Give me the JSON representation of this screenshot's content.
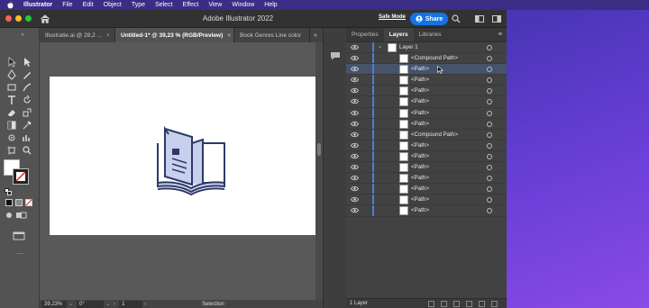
{
  "menubar": {
    "items": [
      "Illustrator",
      "File",
      "Edit",
      "Object",
      "Type",
      "Select",
      "Effect",
      "View",
      "Window",
      "Help"
    ],
    "bg": "#3b2c86"
  },
  "titlebar": {
    "title": "Adobe Illustrator 2022",
    "safe_mode": "Safe Mode",
    "share_label": "Share",
    "accent": "#1473e6"
  },
  "tabs": [
    {
      "label": "Illustratie.ai @ 28,2 ...",
      "active": false
    },
    {
      "label": "Untitled-1* @ 39,23 % (RGB/Preview)",
      "active": true
    },
    {
      "label": "Book Genres Line color",
      "active": false
    }
  ],
  "tabs_overflow": "»",
  "statusbar": {
    "zoom": "39,23%",
    "rotation": "0°",
    "artboard": "1",
    "mode": "Selection"
  },
  "panel": {
    "tabs": [
      "Properties",
      "Layers",
      "Libraries"
    ],
    "active_tab": "Layers",
    "footer": "1 Layer",
    "layer_name": "Layer 1",
    "rows": [
      {
        "label": "<Compound Path>",
        "selected": false
      },
      {
        "label": "<Path>",
        "selected": true
      },
      {
        "label": "<Path>",
        "selected": false
      },
      {
        "label": "<Path>",
        "selected": false
      },
      {
        "label": "<Path>",
        "selected": false
      },
      {
        "label": "<Path>",
        "selected": false
      },
      {
        "label": "<Path>",
        "selected": false
      },
      {
        "label": "<Compound Path>",
        "selected": false
      },
      {
        "label": "<Path>",
        "selected": false
      },
      {
        "label": "<Path>",
        "selected": false
      },
      {
        "label": "<Path>",
        "selected": false
      },
      {
        "label": "<Path>",
        "selected": false
      },
      {
        "label": "<Path>",
        "selected": false
      },
      {
        "label": "<Path>",
        "selected": false
      },
      {
        "label": "<Path>",
        "selected": false
      }
    ],
    "accent": "#4a7fd4"
  },
  "artwork": {
    "stroke": "#2e3a66",
    "fill": "#c7d0ec"
  }
}
